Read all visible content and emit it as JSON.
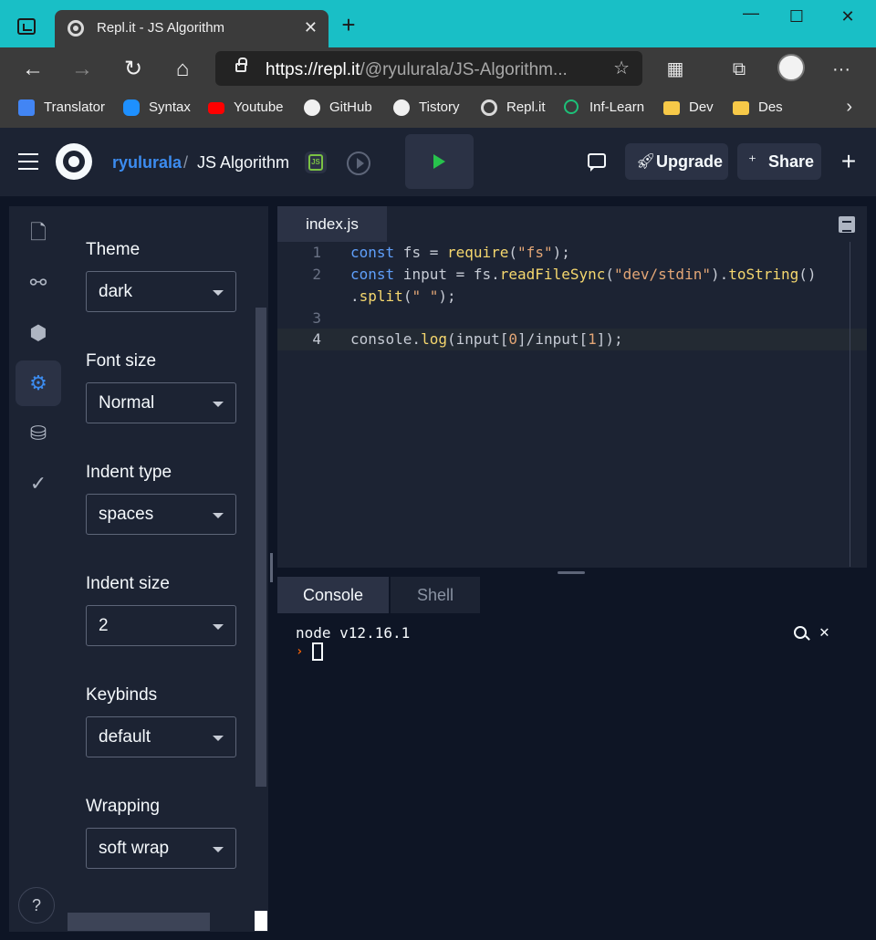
{
  "browser": {
    "tab_title": "Repl.it - JS Algorithm",
    "tab_close": "✕",
    "new_tab": "+",
    "url_host": "https://repl.it",
    "url_path": "/@ryulurala/JS-Algorithm...",
    "bookmarks": [
      {
        "label": "Translator",
        "icon": "translator-icon",
        "color": "#4285f4"
      },
      {
        "label": "Syntax",
        "icon": "syntax-icon",
        "color": "#1e90ff"
      },
      {
        "label": "Youtube",
        "icon": "youtube-icon",
        "color": "#ff0000"
      },
      {
        "label": "GitHub",
        "icon": "github-icon",
        "color": "#f0f0f0"
      },
      {
        "label": "Tistory",
        "icon": "tistory-icon",
        "color": "#f0f0f0"
      },
      {
        "label": "Repl.it",
        "icon": "replit-icon",
        "color": "#d9d9d9"
      },
      {
        "label": "Inf-Learn",
        "icon": "inflearn-icon",
        "color": "#1dc078"
      },
      {
        "label": "Dev",
        "icon": "folder-icon",
        "color": "#f7c948"
      },
      {
        "label": "Des",
        "icon": "folder-icon",
        "color": "#f7c948"
      }
    ]
  },
  "header": {
    "user": "ryulurala",
    "separator": "/",
    "repl_name": "JS Algorithm",
    "lang_badge": "JS",
    "upgrade_label": "Upgrade",
    "share_label": "Share",
    "plus": "+"
  },
  "settings": {
    "fields": [
      {
        "label": "Theme",
        "value": "dark"
      },
      {
        "label": "Font size",
        "value": "Normal"
      },
      {
        "label": "Indent type",
        "value": "spaces"
      },
      {
        "label": "Indent size",
        "value": "2"
      },
      {
        "label": "Keybinds",
        "value": "default"
      },
      {
        "label": "Wrapping",
        "value": "soft wrap"
      }
    ],
    "help": "?"
  },
  "editor": {
    "file_tab": "index.js",
    "active_line": 4,
    "line_numbers": [
      "1",
      "2",
      "",
      "3",
      "4"
    ]
  },
  "console": {
    "tabs": [
      "Console",
      "Shell"
    ],
    "output": "node v12.16.1",
    "prompt": "›"
  },
  "colors": {
    "accent": "#3c8cf0",
    "run": "#27c24c",
    "titlebar": "#19bfc6"
  }
}
